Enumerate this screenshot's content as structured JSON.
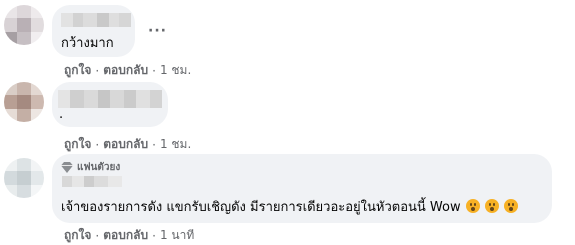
{
  "comments": [
    {
      "text": "กว้างมาก",
      "more_label": "···",
      "like_label": "ถูกใจ",
      "reply_label": "ตอบกลับ",
      "time": "1 ชม."
    },
    {
      "text": ".",
      "like_label": "ถูกใจ",
      "reply_label": "ตอบกลับ",
      "time": "1 ชม."
    },
    {
      "badge": "แฟนตัวยง",
      "text": "เจ้าของรายการดัง แขกรับเชิญดัง มีรายการเดียวอะอยู่ในหัวตอนนี้ Wow",
      "emojis": [
        "astonished-face-icon",
        "astonished-face-icon",
        "astonished-face-icon"
      ],
      "like_label": "ถูกใจ",
      "reply_label": "ตอบกลับ",
      "time": "1 นาที"
    }
  ],
  "separator": "·",
  "colors": {
    "bubble": "#f0f2f5",
    "meta_text": "#65676b",
    "emoji": "#f7b125"
  }
}
